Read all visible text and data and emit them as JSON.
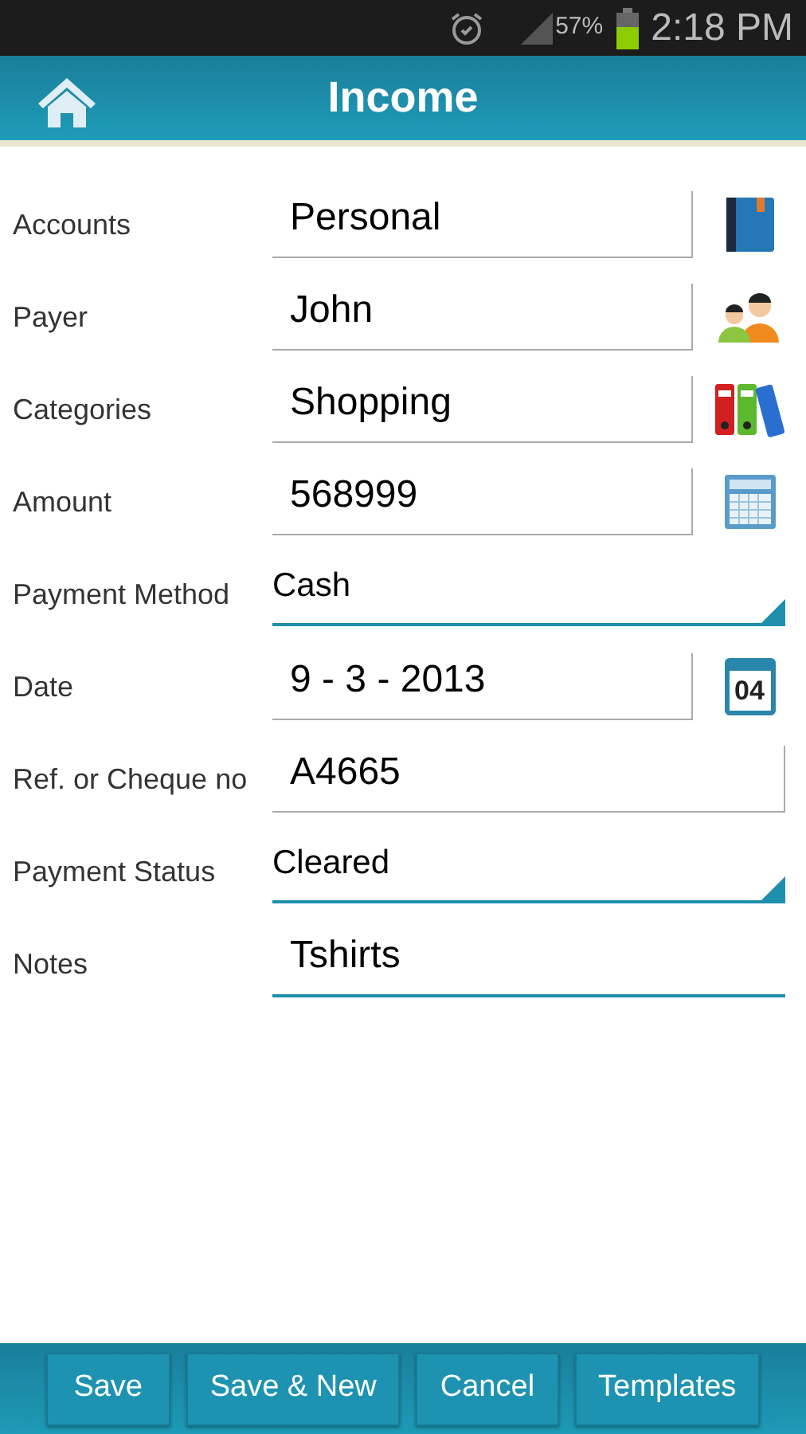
{
  "status_bar": {
    "battery": "57%",
    "time": "2:18 PM"
  },
  "header": {
    "title": "Income"
  },
  "fields": [
    {
      "label": "Accounts",
      "kind": "text",
      "value": "Personal",
      "focused": false
    },
    {
      "label": "Payer",
      "kind": "text",
      "value": "John",
      "focused": false
    },
    {
      "label": "Categories",
      "kind": "text",
      "value": "Shopping",
      "focused": false
    },
    {
      "label": "Amount",
      "kind": "text",
      "value": "568999",
      "focused": false
    },
    {
      "label": "Payment Method",
      "kind": "dropdown",
      "value": "Cash"
    },
    {
      "label": "Date",
      "kind": "text",
      "value": "9 - 3 - 2013",
      "icon_text": "04",
      "focused": false
    },
    {
      "label": "Ref. or Cheque no",
      "kind": "text",
      "value": "A4665",
      "focused": false
    },
    {
      "label": "Payment Status",
      "kind": "dropdown",
      "value": "Cleared"
    },
    {
      "label": "Notes",
      "kind": "text",
      "value": "Tshirts",
      "focused": true
    }
  ],
  "buttons": [
    "Save",
    "Save & New",
    "Cancel",
    "Templates"
  ]
}
